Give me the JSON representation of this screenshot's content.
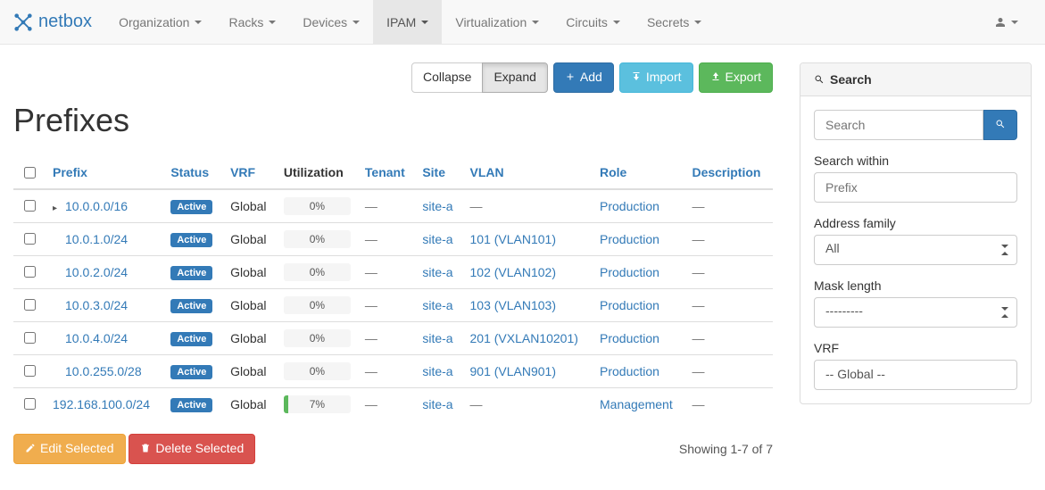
{
  "brand": "netbox",
  "nav": {
    "items": [
      "Organization",
      "Racks",
      "Devices",
      "IPAM",
      "Virtualization",
      "Circuits",
      "Secrets"
    ],
    "active_index": 3
  },
  "actions": {
    "collapse": "Collapse",
    "expand": "Expand",
    "add": "Add",
    "import": "Import",
    "export": "Export"
  },
  "page_title": "Prefixes",
  "columns": {
    "prefix": "Prefix",
    "status": "Status",
    "vrf": "VRF",
    "utilization": "Utilization",
    "tenant": "Tenant",
    "site": "Site",
    "vlan": "VLAN",
    "role": "Role",
    "description": "Description"
  },
  "status_label": "Active",
  "rows": [
    {
      "prefix": "10.0.0.0/16",
      "indent": 0,
      "expand": true,
      "status": "Active",
      "vrf": "Global",
      "util_pct": 0,
      "util_text": "0%",
      "tenant": "—",
      "site": "site-a",
      "vlan": "—",
      "role": "Production",
      "description": "—"
    },
    {
      "prefix": "10.0.1.0/24",
      "indent": 1,
      "expand": false,
      "status": "Active",
      "vrf": "Global",
      "util_pct": 0,
      "util_text": "0%",
      "tenant": "—",
      "site": "site-a",
      "vlan": "101 (VLAN101)",
      "role": "Production",
      "description": "—"
    },
    {
      "prefix": "10.0.2.0/24",
      "indent": 1,
      "expand": false,
      "status": "Active",
      "vrf": "Global",
      "util_pct": 0,
      "util_text": "0%",
      "tenant": "—",
      "site": "site-a",
      "vlan": "102 (VLAN102)",
      "role": "Production",
      "description": "—"
    },
    {
      "prefix": "10.0.3.0/24",
      "indent": 1,
      "expand": false,
      "status": "Active",
      "vrf": "Global",
      "util_pct": 0,
      "util_text": "0%",
      "tenant": "—",
      "site": "site-a",
      "vlan": "103 (VLAN103)",
      "role": "Production",
      "description": "—"
    },
    {
      "prefix": "10.0.4.0/24",
      "indent": 1,
      "expand": false,
      "status": "Active",
      "vrf": "Global",
      "util_pct": 0,
      "util_text": "0%",
      "tenant": "—",
      "site": "site-a",
      "vlan": "201 (VXLAN10201)",
      "role": "Production",
      "description": "—"
    },
    {
      "prefix": "10.0.255.0/28",
      "indent": 1,
      "expand": false,
      "status": "Active",
      "vrf": "Global",
      "util_pct": 0,
      "util_text": "0%",
      "tenant": "—",
      "site": "site-a",
      "vlan": "901 (VLAN901)",
      "role": "Production",
      "description": "—"
    },
    {
      "prefix": "192.168.100.0/24",
      "indent": 0,
      "expand": false,
      "status": "Active",
      "vrf": "Global",
      "util_pct": 7,
      "util_text": "7%",
      "tenant": "—",
      "site": "site-a",
      "vlan": "—",
      "role": "Management",
      "description": "—"
    }
  ],
  "bulk": {
    "edit": "Edit Selected",
    "delete": "Delete Selected"
  },
  "pagination": "Showing 1-7 of 7",
  "search": {
    "heading": "Search",
    "placeholder": "Search",
    "within_label": "Search within",
    "within_placeholder": "Prefix",
    "family_label": "Address family",
    "family_value": "All",
    "mask_label": "Mask length",
    "mask_value": "---------",
    "vrf_label": "VRF",
    "vrf_option": "-- Global --"
  }
}
